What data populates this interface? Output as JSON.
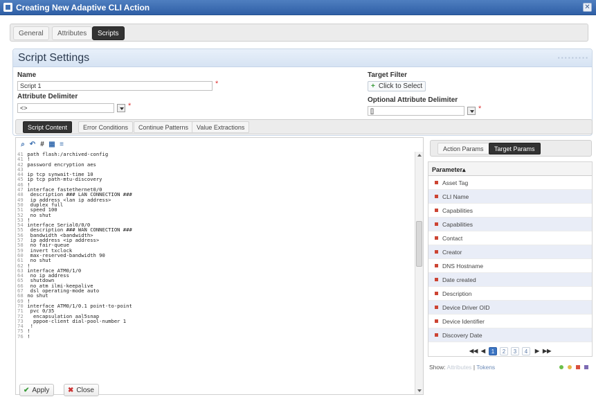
{
  "window": {
    "title": "Creating New Adaptive CLI Action"
  },
  "top_tabs": [
    {
      "label": "General"
    },
    {
      "label": "Attributes"
    },
    {
      "label": "Scripts"
    }
  ],
  "settings": {
    "title": "Script Settings",
    "name_label": "Name",
    "name_value": "Script 1",
    "attr_delim_label": "Attribute Delimiter",
    "attr_delim_value": "<>",
    "target_filter_label": "Target Filter",
    "target_filter_button": "Click to Select",
    "opt_attr_delim_label": "Optional Attribute Delimiter",
    "opt_attr_delim_value": "[]",
    "required_marker": "*"
  },
  "sub_tabs": [
    {
      "label": "Script Content"
    },
    {
      "label": "Error Conditions"
    },
    {
      "label": "Continue Patterns"
    },
    {
      "label": "Value Extractions"
    }
  ],
  "editor": {
    "toolbar_glyphs": [
      "⌕",
      "↶",
      "#",
      "▦",
      "≡"
    ],
    "lines": [
      {
        "n": "41",
        "t": " path flash:/archived-config"
      },
      {
        "n": "41",
        "t": " !"
      },
      {
        "n": "42",
        "t": " password encryption aes"
      },
      {
        "n": "43",
        "t": ""
      },
      {
        "n": "44",
        "t": " ip tcp synwait-time 10"
      },
      {
        "n": "45",
        "t": " ip tcp path-mtu-discovery"
      },
      {
        "n": "46",
        "t": " !"
      },
      {
        "n": "47",
        "t": " interface fastethernet0/0"
      },
      {
        "n": "48",
        "t": "  description ### LAN CONNECTION ###"
      },
      {
        "n": "49",
        "t": "  ip address <lan ip address>"
      },
      {
        "n": "50",
        "t": "  duplex full"
      },
      {
        "n": "51",
        "t": "  speed 100"
      },
      {
        "n": "52",
        "t": "  no shut"
      },
      {
        "n": "53",
        "t": " !"
      },
      {
        "n": "54",
        "t": " interface Serial0/0/0"
      },
      {
        "n": "55",
        "t": "  description ### WAN CONNECTION ###"
      },
      {
        "n": "56",
        "t": "  bandwidth <bandwidth>"
      },
      {
        "n": "57",
        "t": "  ip address <ip address>"
      },
      {
        "n": "58",
        "t": "  no fair-queue"
      },
      {
        "n": "59",
        "t": "  invert txclock"
      },
      {
        "n": "60",
        "t": "  max-reserved-bandwidth 90"
      },
      {
        "n": "61",
        "t": "  no shut"
      },
      {
        "n": "62",
        "t": " !"
      },
      {
        "n": "63",
        "t": " interface ATM0/1/0"
      },
      {
        "n": "64",
        "t": "  no ip address"
      },
      {
        "n": "65",
        "t": "  shutdown"
      },
      {
        "n": "66",
        "t": "  no atm ilmi-keepalive"
      },
      {
        "n": "67",
        "t": "  dsl operating-mode auto"
      },
      {
        "n": "68",
        "t": " no shut"
      },
      {
        "n": "69",
        "t": " !"
      },
      {
        "n": "70",
        "t": " interface ATM0/1/0.1 point-to-point"
      },
      {
        "n": "71",
        "t": "  pvc 0/35"
      },
      {
        "n": "72",
        "t": "   encapsulation aal5snap"
      },
      {
        "n": "73",
        "t": "   pppoe-client dial-pool-number 1"
      },
      {
        "n": "74",
        "t": "  !"
      },
      {
        "n": "75",
        "t": " !"
      },
      {
        "n": "76",
        "t": " !"
      }
    ]
  },
  "right_panel": {
    "tabs": [
      {
        "label": "Action Params"
      },
      {
        "label": "Target Params"
      }
    ],
    "column_header": "Parameter",
    "sort_glyph": "▴",
    "rows": [
      {
        "label": "Asset Tag"
      },
      {
        "label": "CLI Name"
      },
      {
        "label": "Capabilities"
      },
      {
        "label": "Capabilities"
      },
      {
        "label": "Contact"
      },
      {
        "label": "Creator"
      },
      {
        "label": "DNS Hostname"
      },
      {
        "label": "Date created"
      },
      {
        "label": "Description"
      },
      {
        "label": "Device Driver OID"
      },
      {
        "label": "Device Identifier"
      },
      {
        "label": "Discovery Date"
      }
    ],
    "pager": {
      "first": "◀◀",
      "prev": "◀",
      "pages": [
        "1",
        "2",
        "3",
        "4"
      ],
      "next": "▶",
      "last": "▶▶",
      "active_page": "1"
    },
    "show_label": "Show:",
    "show_attributes": "Attributes",
    "show_sep": "|",
    "show_tokens": "Tokens"
  },
  "footer": {
    "apply_label": "Apply",
    "close_label": "Close"
  },
  "colors": {
    "title_bar": "#3d6fb5",
    "active_tab": "#333333",
    "row_alt": "#e9edf7",
    "param_marker": "#cc4433",
    "apply_icon": "#3a9b3a",
    "close_icon": "#cc3333"
  }
}
